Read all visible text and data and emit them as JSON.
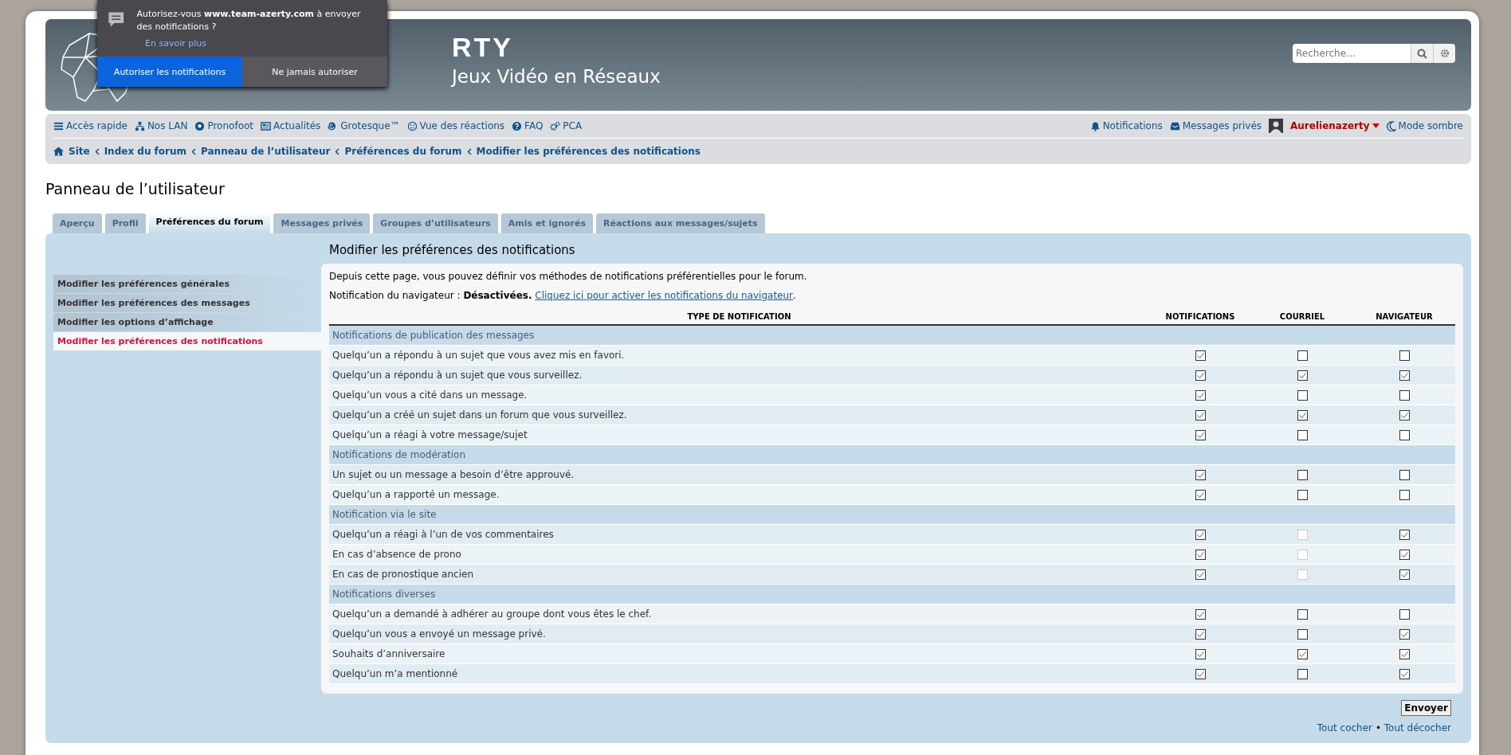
{
  "popup": {
    "message": "Autorisez-vous **www.team-azerty.com** à envoyer des notifications ?",
    "learn_more": "En savoir plus",
    "buttons": [
      {
        "label": "Autoriser les notifications",
        "kind": "primary"
      },
      {
        "label": "Ne jamais autoriser",
        "kind": "secondary"
      }
    ]
  },
  "header": {
    "logo_text": "RTY",
    "tagline": "Jeux Vidéo en Réseaux",
    "search": {
      "placeholder": "Recherche…"
    }
  },
  "nav": {
    "left": [
      {
        "label": "Accès rapide",
        "kind": "menu"
      },
      {
        "label": "Nos LAN",
        "kind": "sitemap"
      },
      {
        "label": "Pronofoot",
        "kind": "ball"
      },
      {
        "label": "Actualités",
        "kind": "news"
      },
      {
        "label": "Grotesque™",
        "kind": "spiral"
      },
      {
        "label": "Vue des réactions",
        "kind": "smile"
      },
      {
        "label": "FAQ",
        "kind": "question"
      },
      {
        "label": "PCA",
        "kind": "gears"
      }
    ],
    "right": [
      {
        "label": "Notifications",
        "kind": "bell"
      },
      {
        "label": "Messages privés",
        "kind": "inbox"
      }
    ],
    "user": "Aurelienazerty",
    "dark_mode": "Mode sombre"
  },
  "breadcrumbs": [
    "Site",
    "Index du forum",
    "Panneau de l’utilisateur",
    "Préférences du forum",
    "Modifier les préférences des notifications"
  ],
  "page_title": "Panneau de l’utilisateur",
  "tabs": [
    {
      "label": "Aperçu",
      "selected": false
    },
    {
      "label": "Profil",
      "selected": false
    },
    {
      "label": "Préférences du forum",
      "selected": true
    },
    {
      "label": "Messages privés",
      "selected": false
    },
    {
      "label": "Groupes d’utilisateurs",
      "selected": false
    },
    {
      "label": "Amis et ignorés",
      "selected": false
    },
    {
      "label": "Réactions aux messages/sujets",
      "selected": false
    }
  ],
  "sidebar": {
    "items": [
      {
        "label": "Modifier les préférences générales",
        "selected": false
      },
      {
        "label": "Modifier les préférences des messages",
        "selected": false
      },
      {
        "label": "Modifier les options d’affichage",
        "selected": false
      },
      {
        "label": "Modifier les préférences des notifications",
        "selected": true
      }
    ]
  },
  "content": {
    "title": "Modifier les préférences des notifications",
    "intro": "Depuis cette page, vous pouvez définir vos méthodes de notifications préférentielles pour le forum.",
    "browser_status": "Notification du navigateur : **Désactivées.**",
    "enable_link": "Cliquez ici pour activer les notifications du navigateur",
    "link_suffix": ".",
    "table": {
      "columns": [
        "TYPE DE NOTIFICATION",
        "NOTIFICATIONS",
        "COURRIEL",
        "NAVIGATEUR"
      ],
      "groups": [
        {
          "title": "Notifications de publication des messages",
          "rows": [
            {
              "label": "Quelqu’un a répondu à un sujet que vous avez mis en favori.",
              "checks": [
                {
                  "checked": true,
                  "disabled": false
                },
                {
                  "checked": false,
                  "disabled": false
                },
                {
                  "checked": false,
                  "disabled": false
                }
              ]
            },
            {
              "label": "Quelqu’un a répondu à un sujet que vous surveillez.",
              "checks": [
                {
                  "checked": true,
                  "disabled": false
                },
                {
                  "checked": true,
                  "disabled": false
                },
                {
                  "checked": true,
                  "disabled": false
                }
              ]
            },
            {
              "label": "Quelqu’un vous a cité dans un message.",
              "checks": [
                {
                  "checked": true,
                  "disabled": false
                },
                {
                  "checked": false,
                  "disabled": false
                },
                {
                  "checked": false,
                  "disabled": false
                }
              ]
            },
            {
              "label": "Quelqu’un a créé un sujet dans un forum que vous surveillez.",
              "checks": [
                {
                  "checked": true,
                  "disabled": false
                },
                {
                  "checked": true,
                  "disabled": false
                },
                {
                  "checked": true,
                  "disabled": false
                }
              ]
            },
            {
              "label": "Quelqu’un a réagi à votre message/sujet",
              "checks": [
                {
                  "checked": true,
                  "disabled": false
                },
                {
                  "checked": false,
                  "disabled": false
                },
                {
                  "checked": false,
                  "disabled": false
                }
              ]
            }
          ]
        },
        {
          "title": "Notifications de modération",
          "rows": [
            {
              "label": "Un sujet ou un message a besoin d’être approuvé.",
              "checks": [
                {
                  "checked": true,
                  "disabled": false
                },
                {
                  "checked": false,
                  "disabled": false
                },
                {
                  "checked": false,
                  "disabled": false
                }
              ]
            },
            {
              "label": "Quelqu’un a rapporté un message.",
              "checks": [
                {
                  "checked": true,
                  "disabled": false
                },
                {
                  "checked": false,
                  "disabled": false
                },
                {
                  "checked": false,
                  "disabled": false
                }
              ]
            }
          ]
        },
        {
          "title": "Notification via le site",
          "rows": [
            {
              "label": "Quelqu’un a réagi à l’un de vos commentaires",
              "checks": [
                {
                  "checked": true,
                  "disabled": false
                },
                {
                  "checked": false,
                  "disabled": true
                },
                {
                  "checked": true,
                  "disabled": false
                }
              ]
            },
            {
              "label": "En cas d’absence de prono",
              "checks": [
                {
                  "checked": true,
                  "disabled": false
                },
                {
                  "checked": false,
                  "disabled": true
                },
                {
                  "checked": true,
                  "disabled": false
                }
              ]
            },
            {
              "label": "En cas de pronostique ancien",
              "checks": [
                {
                  "checked": true,
                  "disabled": false
                },
                {
                  "checked": false,
                  "disabled": true
                },
                {
                  "checked": true,
                  "disabled": false
                }
              ]
            }
          ]
        },
        {
          "title": "Notifications diverses",
          "rows": [
            {
              "label": "Quelqu’un a demandé à adhérer au groupe dont vous êtes le chef.",
              "checks": [
                {
                  "checked": true,
                  "disabled": false
                },
                {
                  "checked": false,
                  "disabled": false
                },
                {
                  "checked": false,
                  "disabled": false
                }
              ]
            },
            {
              "label": "Quelqu’un vous a envoyé un message privé.",
              "checks": [
                {
                  "checked": true,
                  "disabled": false
                },
                {
                  "checked": false,
                  "disabled": false
                },
                {
                  "checked": true,
                  "disabled": false
                }
              ]
            },
            {
              "label": "Souhaits d’anniversaire",
              "checks": [
                {
                  "checked": true,
                  "disabled": false
                },
                {
                  "checked": true,
                  "disabled": false
                },
                {
                  "checked": true,
                  "disabled": false
                }
              ]
            },
            {
              "label": "Quelqu’un m’a mentionné",
              "checks": [
                {
                  "checked": true,
                  "disabled": false
                },
                {
                  "checked": false,
                  "disabled": false
                },
                {
                  "checked": true,
                  "disabled": false
                }
              ]
            }
          ]
        }
      ]
    }
  },
  "footer": {
    "submit": "Envoyer",
    "check_all": "Tout cocher",
    "separator": "•",
    "uncheck_all": "Tout décocher"
  }
}
